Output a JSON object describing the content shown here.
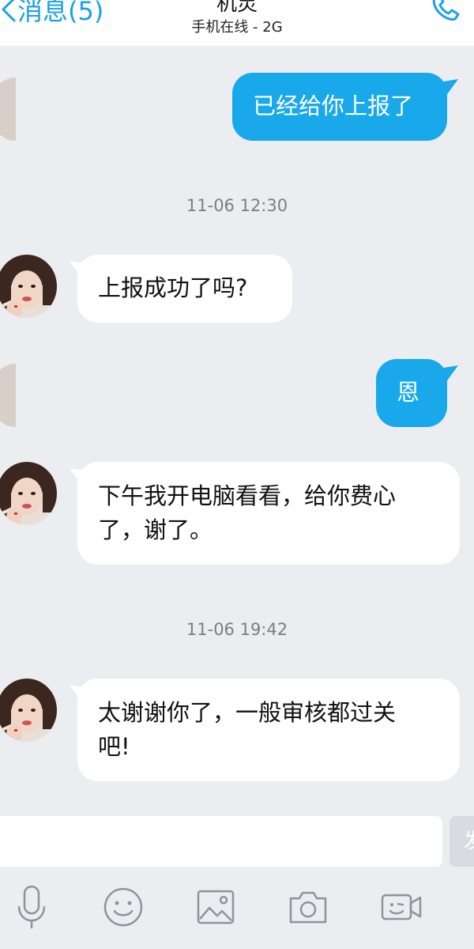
{
  "header": {
    "back_label": "消息(5)",
    "title": "机灵",
    "status": "手机在线 - 2G",
    "call_icon": "phone-icon"
  },
  "messages": [
    {
      "side": "out",
      "text": "已经给你上报了"
    },
    {
      "kind": "timestamp",
      "text": "11-06 12:30"
    },
    {
      "side": "in",
      "text": "上报成功了吗?"
    },
    {
      "side": "out",
      "text": "恩"
    },
    {
      "side": "in",
      "line1": "下午我开电脑看看，给你费心",
      "line2": "了，谢了。"
    },
    {
      "kind": "timestamp",
      "text": "11-06 19:42"
    },
    {
      "side": "in",
      "line1": "太谢谢你了，一般审核都过关",
      "line2": "吧!"
    }
  ],
  "input": {
    "value": "",
    "send_label": "发"
  },
  "toolbar": [
    {
      "icon": "microphone-icon"
    },
    {
      "icon": "emoji-icon"
    },
    {
      "icon": "image-icon"
    },
    {
      "icon": "camera-icon"
    },
    {
      "icon": "video-icon"
    }
  ],
  "colors": {
    "accent": "#1aa1e6",
    "outgoing_bubble": "#19a8ea",
    "incoming_bubble": "#ffffff",
    "background": "#ebedf1",
    "timestamp_text": "#7a7d82"
  }
}
